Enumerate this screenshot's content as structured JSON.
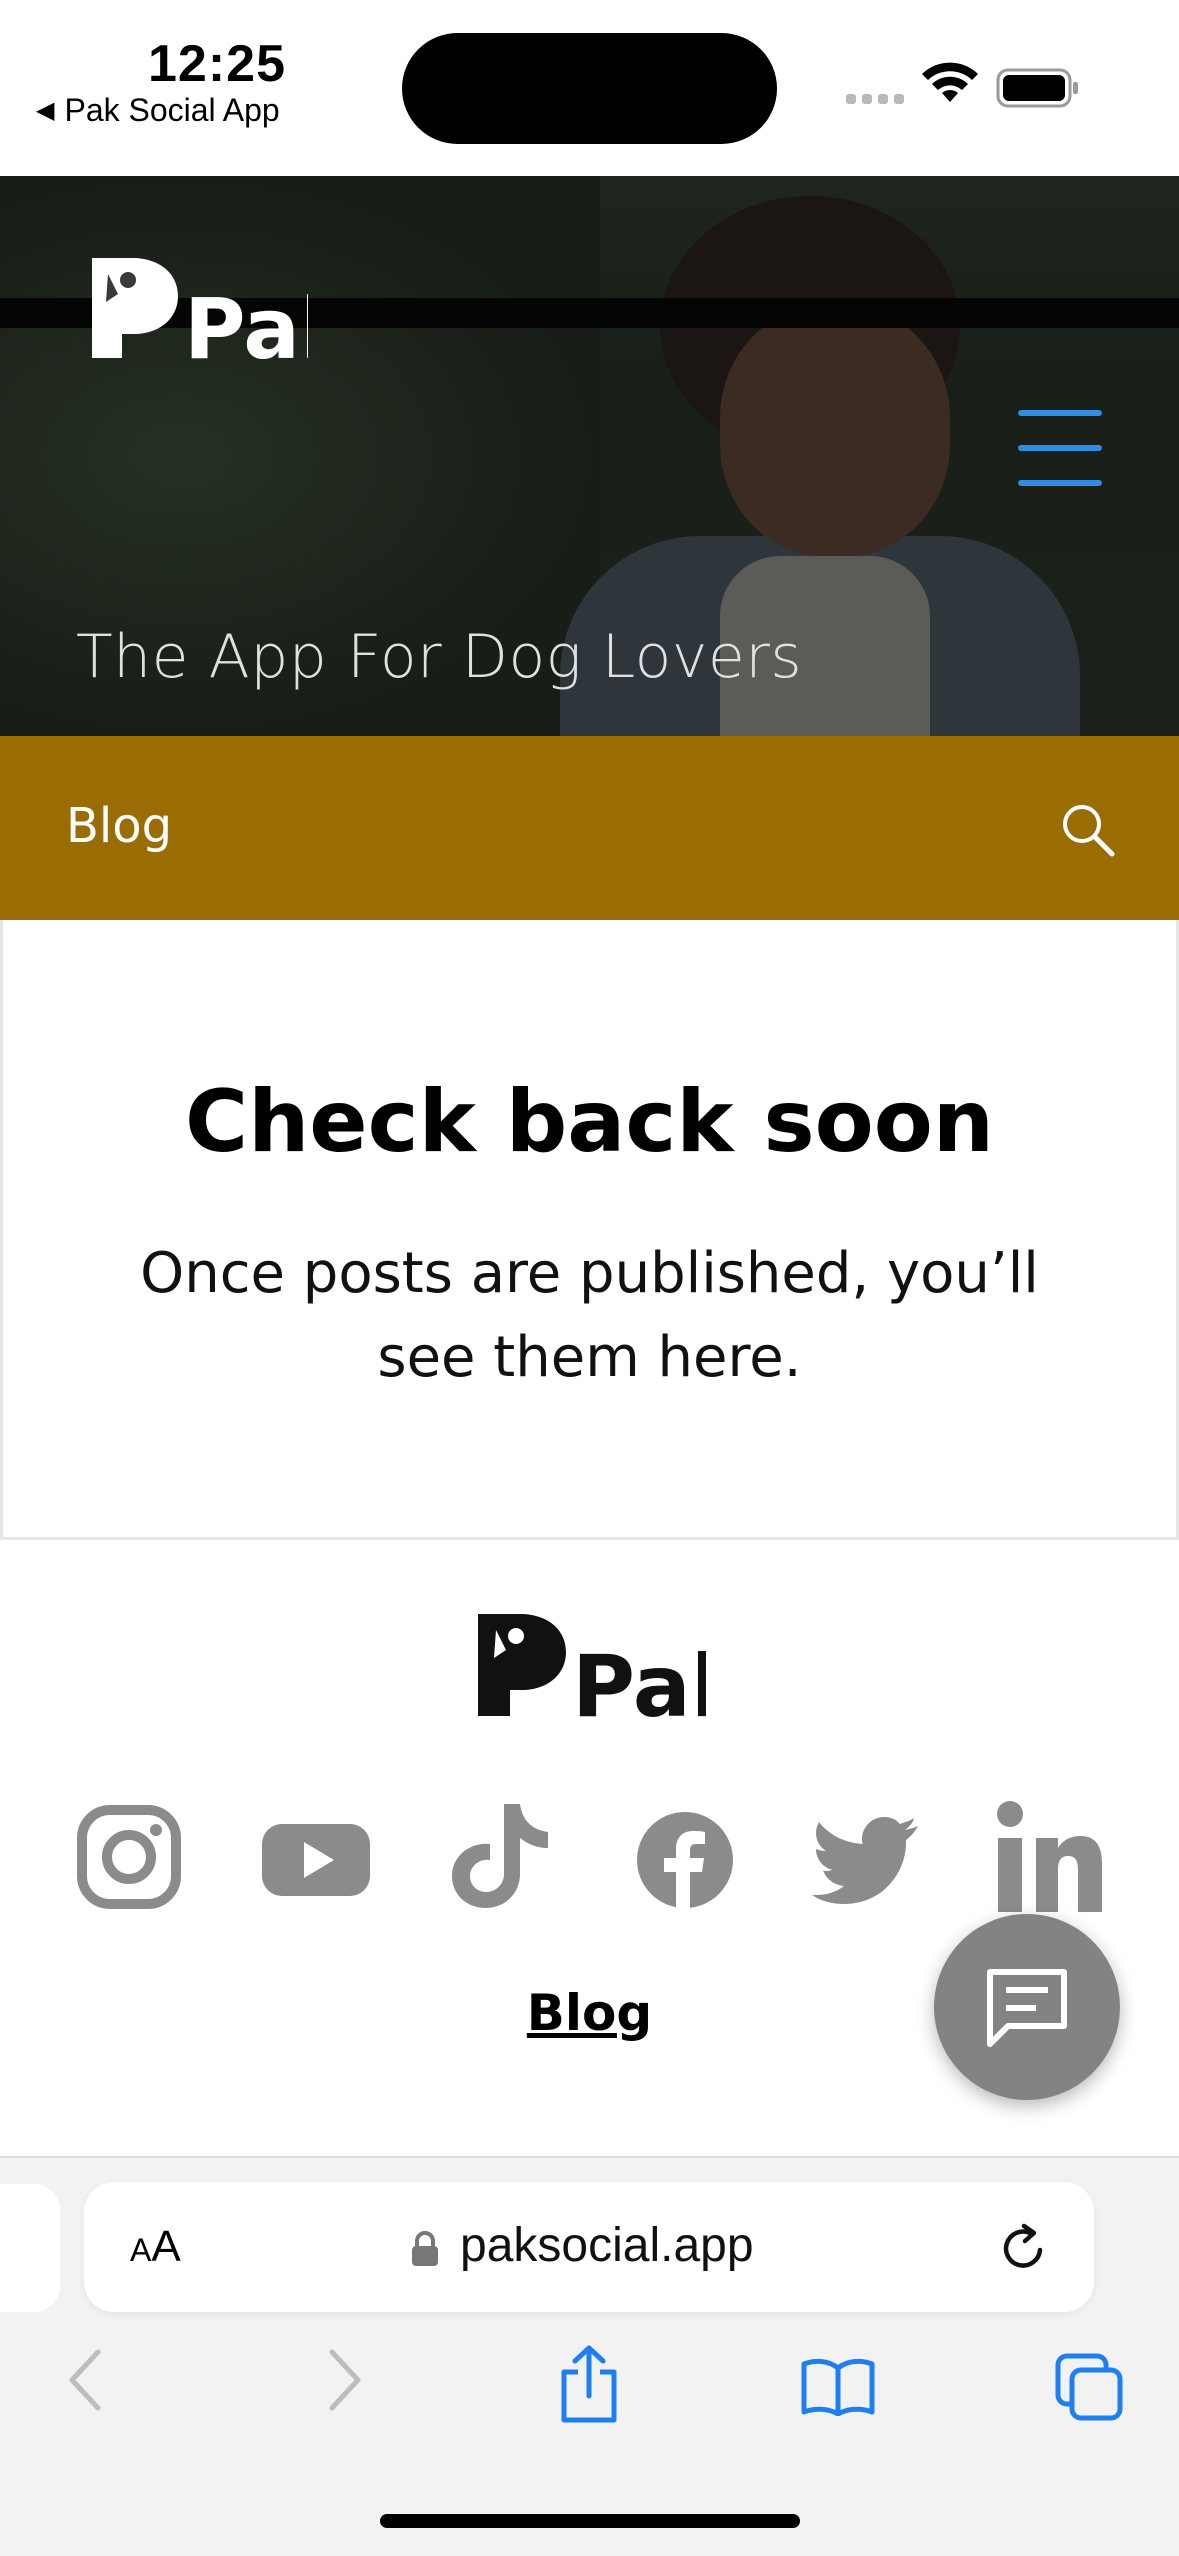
{
  "status_bar": {
    "time": "12:25",
    "back_app": "Pak Social App",
    "back_arrow": "◀"
  },
  "hero": {
    "logo_text": "Pak",
    "tagline": "The App For Dog Lovers",
    "menu_icon": "hamburger-menu-icon",
    "menu_color": "#2f8de4"
  },
  "nav": {
    "label": "Blog",
    "search_icon": "search-icon",
    "bg_color": "#9a6d04"
  },
  "main": {
    "headline": "Check back soon",
    "subtext": "Once posts are published, you’ll see them here."
  },
  "footer": {
    "logo_text": "Pak",
    "social_icons": [
      "instagram-icon",
      "youtube-icon",
      "tiktok-icon",
      "facebook-icon",
      "twitter-icon",
      "linkedin-icon"
    ],
    "blog_link": "Blog",
    "chat_icon": "chat-icon"
  },
  "browser": {
    "text_size_big": "A",
    "text_size_small": "A",
    "url": "paksocial.app",
    "toolbar_icons": [
      "back-icon",
      "forward-icon",
      "share-icon",
      "bookmarks-icon",
      "tabs-icon"
    ]
  }
}
